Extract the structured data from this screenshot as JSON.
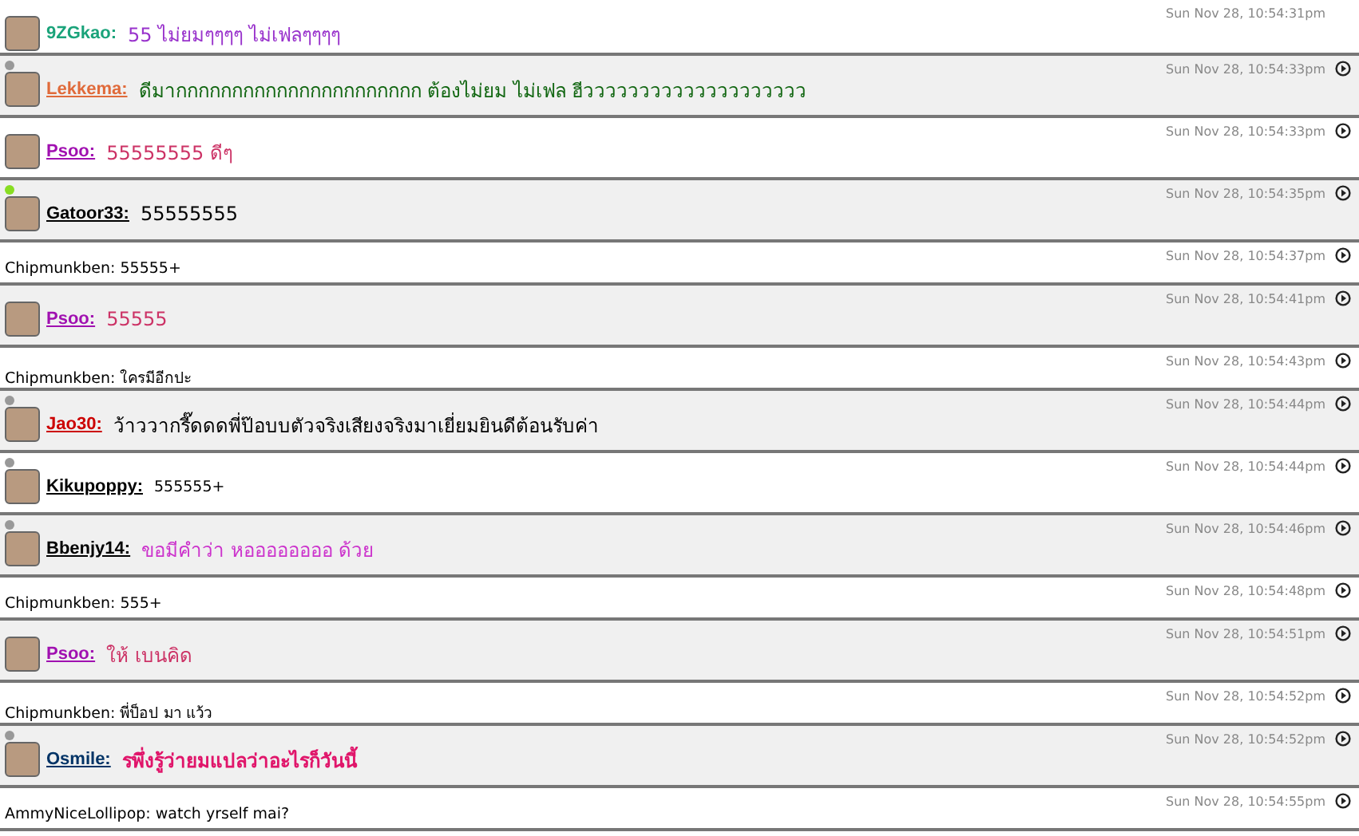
{
  "messages": [
    {
      "kind": "user",
      "shaded": false,
      "name": {
        "text": "9ZGkao:",
        "color": "#1aa37a",
        "underlined": false
      },
      "message": {
        "text": "55 ไม่ยมๆๆๆๆ ไม่เฟลๆๆๆๆ",
        "color": "#9933cc",
        "small": false,
        "bold": false
      },
      "time": "Sun Nov 28, 10:54:31pm",
      "reply": false
    },
    {
      "kind": "user",
      "shaded": true,
      "color": "#999999",
      "name": {
        "text": "Lekkema:",
        "color": "#e06a3a",
        "underlined": true
      },
      "message": {
        "text": "ดีมากกกกกกกกกกกกกกกกกกกกกก ต้องไม่ยม ไม่เฟล ฮีวววววววววววววววววววว",
        "color": "#116611",
        "small": false,
        "bold": false
      },
      "time": "Sun Nov 28, 10:54:33pm",
      "reply": true
    },
    {
      "kind": "user",
      "shaded": false,
      "name": {
        "text": "Psoo:",
        "color": "#a010b0",
        "underlined": true
      },
      "message": {
        "text": "55555555 ดีๆ",
        "color": "#cc3366",
        "small": false,
        "bold": false
      },
      "time": "Sun Nov 28, 10:54:33pm",
      "reply": true
    },
    {
      "kind": "user",
      "shaded": true,
      "color": "#88dd22",
      "name": {
        "text": "Gatoor33:",
        "color": "#000000",
        "underlined": true
      },
      "message": {
        "text": "55555555",
        "color": "#000000",
        "small": false,
        "bold": false
      },
      "time": "Sun Nov 28, 10:54:35pm",
      "reply": true
    },
    {
      "kind": "plain",
      "shaded": false,
      "text": "Chipmunkben: 55555+",
      "time": "Sun Nov 28, 10:54:37pm",
      "reply": true
    },
    {
      "kind": "user",
      "shaded": true,
      "name": {
        "text": "Psoo:",
        "color": "#a010b0",
        "underlined": true
      },
      "message": {
        "text": "55555",
        "color": "#cc3366",
        "small": false,
        "bold": false
      },
      "time": "Sun Nov 28, 10:54:41pm",
      "reply": true
    },
    {
      "kind": "plain",
      "shaded": false,
      "text": "Chipmunkben: ใครมีอีกปะ",
      "time": "Sun Nov 28, 10:54:43pm",
      "reply": true
    },
    {
      "kind": "user",
      "shaded": true,
      "color": "#999999",
      "name": {
        "text": "Jao30:",
        "color": "#cc0000",
        "underlined": true
      },
      "message": {
        "text": "ว้าววากรี๊ดดดพี่ป๊อบบตัวจริงเสียงจริงมาเยี่ยมยินดีต้อนรับค่า",
        "color": "#000000",
        "small": false,
        "bold": false
      },
      "time": "Sun Nov 28, 10:54:44pm",
      "reply": true
    },
    {
      "kind": "user",
      "shaded": false,
      "color": "#999999",
      "name": {
        "text": "Kikupoppy:",
        "color": "#000000",
        "underlined": true
      },
      "message": {
        "text": "555555+",
        "color": "#000000",
        "small": true,
        "bold": false
      },
      "time": "Sun Nov 28, 10:54:44pm",
      "reply": true
    },
    {
      "kind": "user",
      "shaded": true,
      "color": "#999999",
      "name": {
        "text": "Bbenjy14:",
        "color": "#000000",
        "underlined": true
      },
      "message": {
        "text": "ขอมีคำว่า หออออออออ ด้วย",
        "color": "#cc33cc",
        "small": false,
        "bold": false
      },
      "time": "Sun Nov 28, 10:54:46pm",
      "reply": true
    },
    {
      "kind": "plain",
      "shaded": false,
      "text": "Chipmunkben: 555+",
      "time": "Sun Nov 28, 10:54:48pm",
      "reply": true
    },
    {
      "kind": "user",
      "shaded": true,
      "name": {
        "text": "Psoo:",
        "color": "#a010b0",
        "underlined": true
      },
      "message": {
        "text": "ให้ เบนคิด",
        "color": "#cc3366",
        "small": false,
        "bold": false
      },
      "time": "Sun Nov 28, 10:54:51pm",
      "reply": true
    },
    {
      "kind": "plain",
      "shaded": false,
      "text": "Chipmunkben: พี่ป็อป มา แว้ว",
      "time": "Sun Nov 28, 10:54:52pm",
      "reply": true
    },
    {
      "kind": "user",
      "shaded": true,
      "color": "#999999",
      "name": {
        "text": "Osmile:",
        "color": "#003366",
        "underlined": true
      },
      "message": {
        "text": "รพึ่งรู้ว่ายมแปลว่าอะไรก็วันนี้",
        "color": "#e0156a",
        "small": false,
        "bold": true
      },
      "time": "Sun Nov 28, 10:54:52pm",
      "reply": true
    },
    {
      "kind": "plain",
      "shaded": false,
      "text": "AmmyNiceLollipop: watch yrself mai?",
      "time": "Sun Nov 28, 10:54:55pm",
      "reply": true
    }
  ]
}
